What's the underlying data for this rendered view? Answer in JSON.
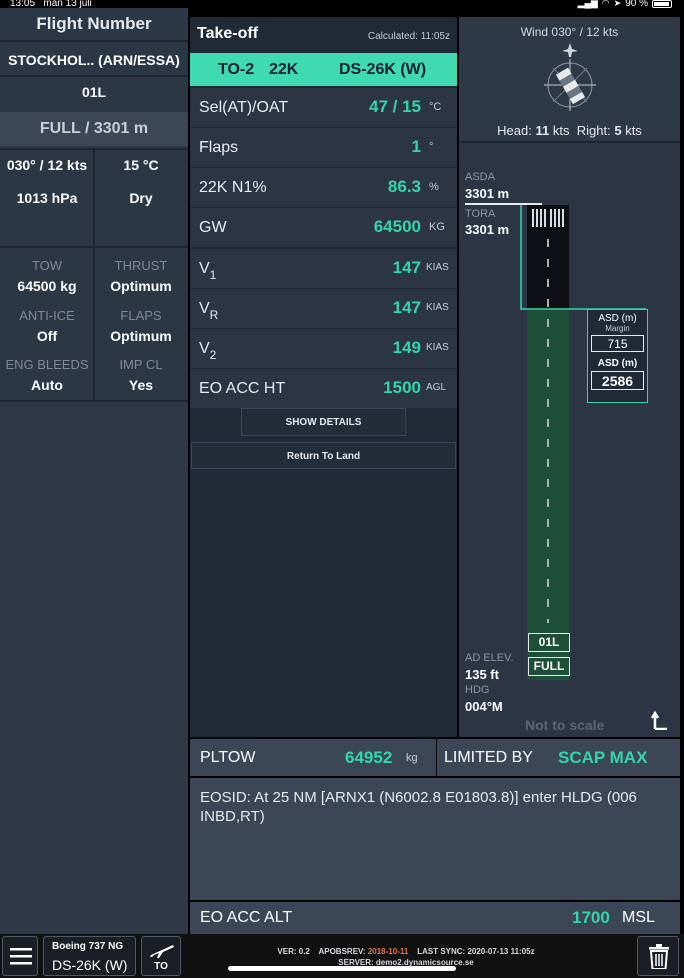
{
  "status_bar": {
    "time": "13:05",
    "date": "mån 13 juli",
    "battery": "90 %"
  },
  "left": {
    "title": "Flight Number",
    "airport": "STOCKHOL.. (ARN/ESSA)",
    "runway": "01L",
    "runway_length": "FULL / 3301 m",
    "wind": "030° / 12 kts",
    "temp": "15 °C",
    "qnh": "1013 hPa",
    "surface": "Dry",
    "config": [
      {
        "label": "TOW",
        "value": "64500 kg"
      },
      {
        "label": "THRUST",
        "value": "Optimum"
      },
      {
        "label": "ANTI-ICE",
        "value": "Off"
      },
      {
        "label": "FLAPS",
        "value": "Optimum"
      },
      {
        "label": "ENG BLEEDS",
        "value": "Auto"
      },
      {
        "label": "IMP CL",
        "value": "Yes"
      }
    ]
  },
  "takeoff": {
    "title": "Take-off",
    "calculated": "Calculated: 11:05z",
    "bar": {
      "mode": "TO-2",
      "thrust": "22K",
      "engine": "DS-26K (W)"
    },
    "rows": [
      {
        "label": "Sel(AT)/OAT",
        "value": "47 / 15",
        "unit": "°C"
      },
      {
        "label": "Flaps",
        "value": "1",
        "unit": "°"
      },
      {
        "label": "22K N1%",
        "value": "86.3",
        "unit": "%"
      },
      {
        "label": "GW",
        "value": "64500",
        "unit": "KG"
      }
    ],
    "speeds": [
      {
        "label": "V",
        "sub": "1",
        "value": "147",
        "unit": "KIAS"
      },
      {
        "label": "V",
        "sub": "R",
        "value": "147",
        "unit": "KIAS"
      },
      {
        "label": "V",
        "sub": "2",
        "value": "149",
        "unit": "KIAS"
      }
    ],
    "eo_acc_ht": {
      "label": "EO ACC HT",
      "value": "1500",
      "unit": "AGL"
    },
    "show_details": "SHOW DETAILS",
    "return_to_land": "Return To Land"
  },
  "runway_panel": {
    "wind_title": "Wind 030° / 12 kts",
    "head_label": "Head:",
    "head_value": "11",
    "head_unit": "kts",
    "right_label": "Right:",
    "right_value": "5",
    "right_unit": "kts",
    "asda_label": "ASDA",
    "asda_value": "3301 m",
    "tora_label": "TORA",
    "tora_value": "3301 m",
    "asd_margin_title": "ASD (m)",
    "asd_margin_sub": "Margin",
    "asd_margin_value": "715",
    "asd_title": "ASD (m)",
    "asd_value": "2586",
    "runway_tag": "01L",
    "runway_full": "FULL",
    "ad_elev_label": "AD ELEV.",
    "ad_elev_value": "135 ft",
    "hdg_label": "HDG",
    "hdg_value": "004°M",
    "not_to_scale": "Not to scale"
  },
  "pltow": {
    "label": "PLTOW",
    "value": "64952",
    "unit": "kg"
  },
  "limited_by": {
    "label": "LIMITED BY",
    "value": "SCAP MAX"
  },
  "eosid": "EOSID: At 25 NM [ARNX1 (N6002.8 E01803.8)] enter HLDG (006 INBD,RT)",
  "eo_acc_alt": {
    "label": "EO ACC ALT",
    "value": "1700",
    "unit": "MSL"
  },
  "footer": {
    "aircraft": "Boeing 737 NG",
    "engine": "DS-26K (W)",
    "to_label": "TO",
    "ver_label": "VER:",
    "ver_value": "0.2",
    "apobs_label": "APOBSREV:",
    "apobs_value": "2018-10-11",
    "sync_label": "LAST SYNC:",
    "sync_value": "2020-07-13 11:05z",
    "server": "SERVER: demo2.dynamicsource.se"
  },
  "colors": {
    "accent": "#33d6a9",
    "apobs": "#e8724a"
  }
}
